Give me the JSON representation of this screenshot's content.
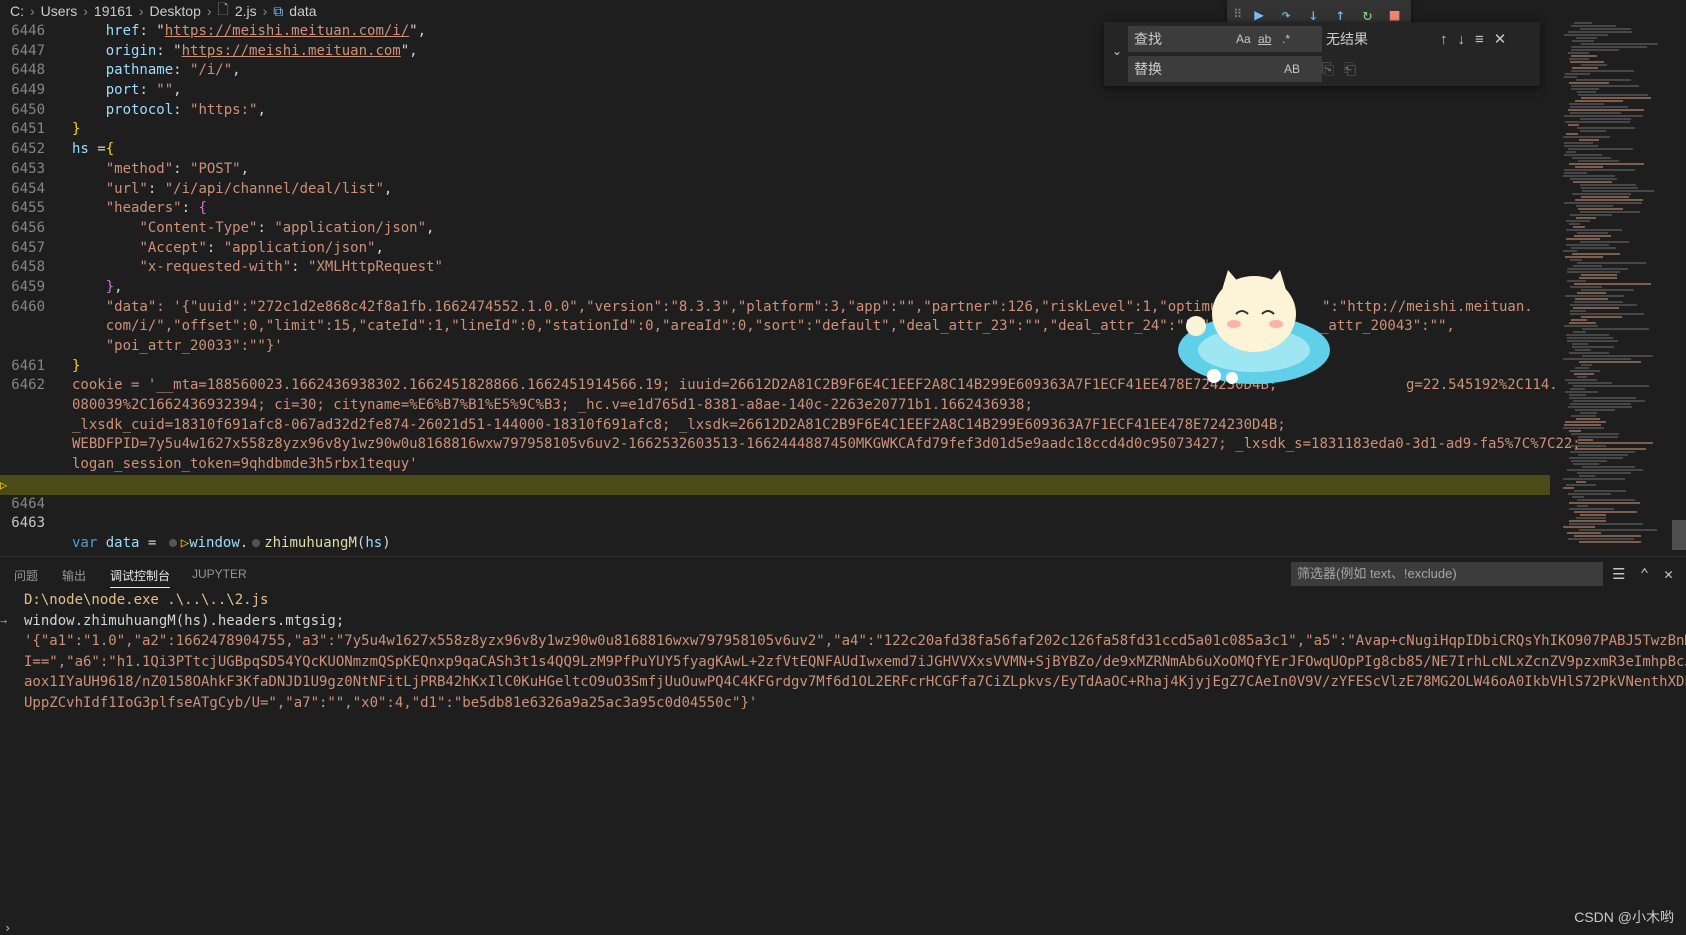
{
  "breadcrumb": {
    "items": [
      "C:",
      "Users",
      "19161",
      "Desktop",
      "2.js",
      "data"
    ]
  },
  "find": {
    "find_placeholder": "查找",
    "replace_placeholder": "替换",
    "opt_case": "Aa",
    "opt_word": "ab",
    "opt_regex": ".*",
    "opt_preserve": "AB",
    "result": "无结果"
  },
  "editor": {
    "lines": [
      {
        "num": "6446",
        "text": "    href: \"https://meishi.meituan.com/i/\","
      },
      {
        "num": "6447",
        "text": "    origin: \"https://meishi.meituan.com\","
      },
      {
        "num": "6448",
        "text": "    pathname: \"/i/\","
      },
      {
        "num": "6449",
        "text": "    port: \"\","
      },
      {
        "num": "6450",
        "text": "    protocol: \"https:\","
      },
      {
        "num": "6451",
        "text": "}"
      },
      {
        "num": "6452",
        "text": "hs ={"
      },
      {
        "num": "6453",
        "text": "    \"method\": \"POST\","
      },
      {
        "num": "6454",
        "text": "    \"url\": \"/i/api/channel/deal/list\","
      },
      {
        "num": "6455",
        "text": "    \"headers\": {"
      },
      {
        "num": "6456",
        "text": "        \"Content-Type\": \"application/json\","
      },
      {
        "num": "6457",
        "text": "        \"Accept\": \"application/json\","
      },
      {
        "num": "6458",
        "text": "        \"x-requested-with\": \"XMLHttpRequest\""
      },
      {
        "num": "6459",
        "text": "    },"
      },
      {
        "num": "6460",
        "text": "    \"data\": '{\"uuid\":\"272c1d2e868c42f8a1fb.1662474552.1.0.0\",\"version\":\"8.3.3\",\"platform\":3,\"app\":\"\",\"partner\":126,\"riskLevel\":1,\"optimusCode\":1",
        "wrap": [
          "    com/i/\",\"offset\":0,\"limit\":15,\"cateId\":1,\"lineId\":0,\"stationId\":0,\"areaId\":0,\"sort\":\"default\",\"deal_attr_23\":\"\",\"deal_attr_24\":\"\",\"dea",
          "    \"poi_attr_20033\":\"\"}'"
        ],
        "tail1": "\":\"http://meishi.meituan.",
        "tail2": "_attr_20043\":\"\","
      },
      {
        "num": "6461",
        "text": "}"
      },
      {
        "num": "6462",
        "text": "cookie = '__mta=188560023.1662436938302.1662451828866.1662451914566.19; iuuid=26612D2A81C2B9F6E4C1EEF2A8C14B299E609363A7F1ECF41EE478E724230D4B;",
        "tail1": "g=22.545192%2C114.",
        "wrap": [
          "080039%2C1662436932394; ci=30; cityname=%E6%B7%B1%E5%9C%B3; _hc.v=e1d765d1-8381-a8ae-140c-2263e20771b1.1662436938;",
          "_lxsdk_cuid=18310f691afc8-067ad32d2fe874-26021d51-144000-18310f691afc8; _lxsdk=26612D2A81C2B9F6E4C1EEF2A8C14B299E609363A7F1ECF41EE478E724230D4B;",
          "WEBDFPID=7y5u4w1627x558z8yzx96v8y1wz90w0u8168816wxw797958105v6uv2-1662532603513-1662444887450MKGWKCAfd79fef3d01d5e9aadc18ccd4d0c95073427; _lxsdk_s=1831183eda0-3d1-ad9-fa5%7C%7C22;",
          "logan_session_token=9qhdbmde3h5rbx1tequy'"
        ]
      },
      {
        "num": "6463",
        "text": "var data = window.zhimuhuangM(hs)"
      },
      {
        "num": "6464",
        "text": ""
      }
    ]
  },
  "panel": {
    "tabs": [
      "问题",
      "输出",
      "调试控制台",
      "JUPYTER"
    ],
    "active_tab": "调试控制台",
    "filter_placeholder": "筛选器(例如 text、!exclude)"
  },
  "console": {
    "lines": [
      "D:\\node\\node.exe .\\..\\..\\2.js",
      "window.zhimuhuangM(hs).headers.mtgsig;",
      "'{\"a1\":\"1.0\",\"a2\":1662478904755,\"a3\":\"7y5u4w1627x558z8yzx96v8y1wz90w0u8168816wxw797958105v6uv2\",\"a4\":\"122c20afd38fa56faf202c126fa58fd31ccd5a01c085a3c1\",\"a5\":\"Avap+cNugiHqpIDbiCRQsYhIKO907PABJ5TwzBnMdO40zJf31",
      "I==\",\"a6\":\"h1.1Qi3PTtcjUGBpqSD54YQcKUONmzmQSpKEQnxp9qaCASh3t1s4QQ9LzM9PfPuYUY5fyagKAwL+2zfVtEQNFAUdIwxemd7iJGHVVXxsVVMN+SjBYBZo/de9xMZRNmAb6uXoOMQfYErJFOwqUOpPIg8cb85/NE7IrhLcNLxZcnZV9pzxmR3eImhpBcJCOU/O68XU",
      "aox1IYaUH9618/nZ0158OAhkF3KfaDNJD1U9gz0NtNFitLjPRB42hKxIlC0KuHGeltcO9uO3SmfjUuOuwPQ4C4KFGrdgv7Mf6d1OL2ERFcrHCGFfa7CiZLpkvs/EyTdAaOC+Rhaj4KjyjEgZ7CAeIn0V9V/zYFEScVlzE78MG2OLW46oA0IkbVHlS72PkVNenthXDPtBPjDOzjU",
      "UppZCvhIdf1IoG3plfseATgCyb/U=\",\"a7\":\"\",\"x0\":4,\"d1\":\"be5db81e6326a9a25ac3a95c0d04550c\"}'"
    ]
  },
  "watermark": "CSDN @小木哟",
  "colors": {
    "background": "#1e1e1e",
    "current_line": "#4b4b18",
    "keyword": "#569cd6",
    "string": "#ce9178",
    "variable": "#9cdcfe"
  }
}
